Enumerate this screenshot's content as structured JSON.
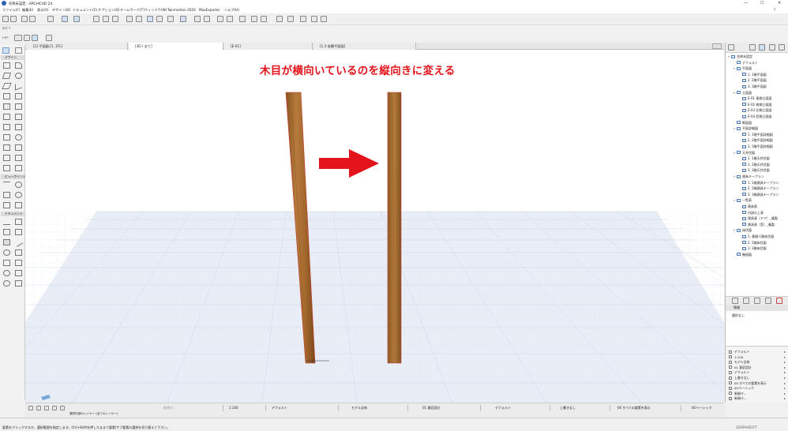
{
  "window": {
    "title": "名称未設定 - ARCHICAD 24",
    "buttons": [
      "—",
      "☐",
      "✕"
    ]
  },
  "menubar": {
    "items": [
      "ファイル(F)",
      "編集(E)",
      "表示(V)",
      "デザイン(D)",
      "ドキュメント(C)",
      "オプション(O)",
      "チームワーク(T)",
      "ウィンドウ(W)",
      "Twinmotion 2020",
      "MaxExporter",
      "ヘルプ(H)"
    ],
    "help_icon": "?"
  },
  "toolbar": {
    "info_label": "ｶﾃｺﾞﾘ",
    "layer_label": "ﾚｲﾔｰ"
  },
  "tabs": [
    {
      "label": "[1] 平面図",
      "active": false
    },
    {
      "label": "[1. 1FL]",
      "active": false
    },
    {
      "label": "[3D / 全て]",
      "active": true
    },
    {
      "label": "[E-01]",
      "active": false
    },
    {
      "label": "[1.3 各種平面図]",
      "active": false
    }
  ],
  "toolbox": {
    "sections": [
      "デザイン",
      "ビューポイント",
      "ドキュメント"
    ]
  },
  "viewport": {
    "heading": "木目が横向いているのを縦向きに変える",
    "heading_color": "#e3141b",
    "arrow_color": "#e3141b"
  },
  "navigator": {
    "items": [
      {
        "label": "名称未設定",
        "level": 0,
        "icon": "project-icon",
        "toggle": "▿"
      },
      {
        "label": "デフォルト",
        "level": 1,
        "icon": "folder-icon",
        "toggle": ""
      },
      {
        "label": "平面図",
        "level": 1,
        "icon": "folder-icon",
        "toggle": "▿"
      },
      {
        "label": "1. 1階平面図",
        "level": 2,
        "icon": "plan-icon",
        "toggle": ""
      },
      {
        "label": "2. 2階平面図",
        "level": 2,
        "icon": "plan-icon",
        "toggle": ""
      },
      {
        "label": "3. 3階平面図",
        "level": 2,
        "icon": "plan-icon",
        "toggle": ""
      },
      {
        "label": "立面図",
        "level": 1,
        "icon": "folder-icon",
        "toggle": "▿"
      },
      {
        "label": "E-01 東側立面図",
        "level": 2,
        "icon": "elevation-icon",
        "toggle": ""
      },
      {
        "label": "E-02 南側立面図",
        "level": 2,
        "icon": "elevation-icon",
        "toggle": ""
      },
      {
        "label": "E-03 北側立面図",
        "level": 2,
        "icon": "elevation-icon",
        "toggle": ""
      },
      {
        "label": "E-04 西側立面図",
        "level": 2,
        "icon": "elevation-icon",
        "toggle": ""
      },
      {
        "label": "断面図",
        "level": 1,
        "icon": "folder-icon",
        "toggle": ""
      },
      {
        "label": "平面詳細図",
        "level": 1,
        "icon": "folder-icon",
        "toggle": "▿"
      },
      {
        "label": "1. 1階平面詳細図",
        "level": 2,
        "icon": "plan-icon",
        "toggle": ""
      },
      {
        "label": "2. 2階平面詳細図",
        "level": 2,
        "icon": "plan-icon",
        "toggle": ""
      },
      {
        "label": "3. 3階平面詳細図",
        "level": 2,
        "icon": "plan-icon",
        "toggle": ""
      },
      {
        "label": "天井伏図",
        "level": 1,
        "icon": "folder-icon",
        "toggle": "▿"
      },
      {
        "label": "1. 1階天井伏図",
        "level": 2,
        "icon": "plan-icon",
        "toggle": ""
      },
      {
        "label": "2. 2階天井伏図",
        "level": 2,
        "icon": "plan-icon",
        "toggle": ""
      },
      {
        "label": "3. 3階天井伏図",
        "level": 2,
        "icon": "plan-icon",
        "toggle": ""
      },
      {
        "label": "建具キープラン",
        "level": 1,
        "icon": "folder-icon",
        "toggle": "▿"
      },
      {
        "label": "1. 1階建具キープラン",
        "level": 2,
        "icon": "plan-icon",
        "toggle": ""
      },
      {
        "label": "2. 2階建具キープラン",
        "level": 2,
        "icon": "plan-icon",
        "toggle": ""
      },
      {
        "label": "3. 3階建具キープラン",
        "level": 2,
        "icon": "plan-icon",
        "toggle": ""
      },
      {
        "label": "一覧表",
        "level": 1,
        "icon": "folder-icon",
        "toggle": "▿"
      },
      {
        "label": "建具表",
        "level": 2,
        "icon": "schedule-icon",
        "toggle": ""
      },
      {
        "label": "内部仕上表",
        "level": 2,
        "icon": "schedule-icon",
        "toggle": ""
      },
      {
        "label": "建具表（ドア）_複製",
        "level": 2,
        "icon": "schedule-icon",
        "toggle": ""
      },
      {
        "label": "建具表（窓）_複製",
        "level": 2,
        "icon": "schedule-icon",
        "toggle": ""
      },
      {
        "label": "床伏図",
        "level": 1,
        "icon": "folder-icon",
        "toggle": "▿"
      },
      {
        "label": "1. 基礎-1階床伏図",
        "level": 2,
        "icon": "plan-icon",
        "toggle": ""
      },
      {
        "label": "2. 2階床伏図",
        "level": 2,
        "icon": "plan-icon",
        "toggle": ""
      },
      {
        "label": "3. 3階床伏図",
        "level": 2,
        "icon": "plan-icon",
        "toggle": ""
      },
      {
        "label": "軸組図",
        "level": 1,
        "icon": "folder-icon",
        "toggle": ""
      }
    ]
  },
  "properties": {
    "title": "情報",
    "value": "選択なし"
  },
  "quick_options": [
    "デフォルト",
    "1:100",
    "モデル全体",
    "01 意匠設計",
    "デフォルト",
    "上書きなし",
    "00 すべての要素を表示",
    "0Gベーシック",
    "新規ｲﾁ...",
    "新規ｲﾁ..."
  ],
  "statusbar": {
    "scale": "1:100",
    "layer_combo": "デフォルト",
    "model_view": "モデル全体",
    "design_option": "01 意匠設計",
    "pen_set": "デフォルト",
    "override": "上書きなし",
    "renovation": "00 すべての要素を表示",
    "mvo": "0Gベーシック",
    "zoom_label": "新規ｲﾁ...",
    "layer_note": "選択内部のレイヤー (全てのレイヤー)"
  },
  "message": {
    "text": "要素をクリックするか、選択範囲を指定します。Ctrl+Shiftを押したままで要素/サブ要素の選択を切り替えて下さい。",
    "brand": "GRAPHISOFT"
  }
}
